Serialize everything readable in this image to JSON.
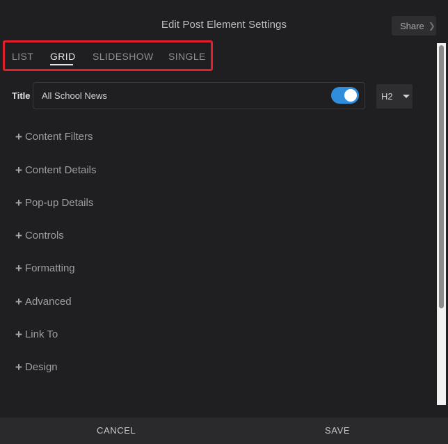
{
  "header": {
    "title": "Edit Post Element Settings",
    "share_label": "Share",
    "share_icon": "chevron-right-icon"
  },
  "tabs": [
    {
      "label": "LIST",
      "active": false
    },
    {
      "label": "GRID",
      "active": true
    },
    {
      "label": "SLIDESHOW",
      "active": false
    },
    {
      "label": "SINGLE",
      "active": false
    }
  ],
  "title_field": {
    "label": "Title",
    "value": "All School News",
    "toggle_on": true,
    "heading_level": "H2"
  },
  "sections": [
    {
      "label": "Content Filters"
    },
    {
      "label": "Content Details"
    },
    {
      "label": "Pop-up Details"
    },
    {
      "label": "Controls"
    },
    {
      "label": "Formatting"
    },
    {
      "label": "Advanced"
    },
    {
      "label": "Link To"
    },
    {
      "label": "Design"
    }
  ],
  "footer": {
    "cancel_label": "CANCEL",
    "save_label": "SAVE"
  },
  "colors": {
    "accent": "#2f8ddc",
    "highlight": "#e0202b",
    "background": "#1f1f21"
  }
}
